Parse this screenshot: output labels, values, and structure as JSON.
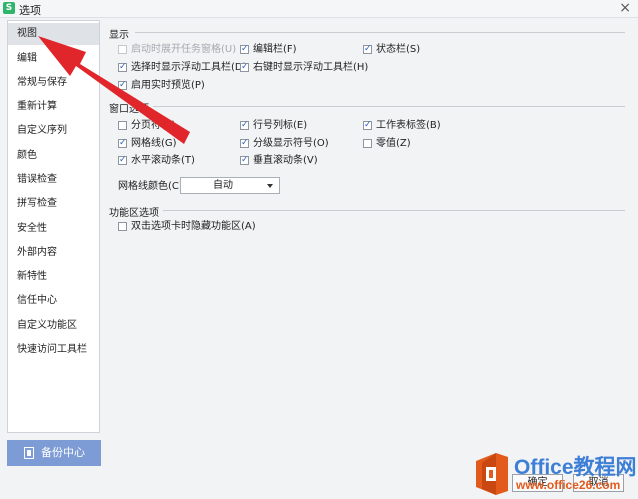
{
  "window": {
    "title": "选项",
    "close_glyph": "×"
  },
  "sidebar": {
    "items": [
      {
        "label": "视图",
        "active": true
      },
      {
        "label": "编辑"
      },
      {
        "label": "常规与保存"
      },
      {
        "label": "重新计算"
      },
      {
        "label": "自定义序列"
      },
      {
        "label": "颜色"
      },
      {
        "label": "错误检查"
      },
      {
        "label": "拼写检查"
      },
      {
        "label": "安全性"
      },
      {
        "label": "外部内容"
      },
      {
        "label": "新特性"
      },
      {
        "label": "信任中心"
      },
      {
        "label": "自定义功能区"
      },
      {
        "label": "快速访问工具栏"
      }
    ],
    "backup_label": "备份中心"
  },
  "display": {
    "title": "显示",
    "options": [
      {
        "label": "启动时展开任务窗格(U)",
        "checked": false,
        "disabled": true
      },
      {
        "label": "编辑栏(F)",
        "checked": true
      },
      {
        "label": "状态栏(S)",
        "checked": true
      },
      {
        "label": "选择时显示浮动工具栏(D)",
        "checked": true
      },
      {
        "label": "右键时显示浮动工具栏(H)",
        "checked": true
      },
      {
        "label": "启用实时预览(P)",
        "checked": true
      }
    ]
  },
  "window_options": {
    "title": "窗口选项",
    "options": [
      {
        "label": "分页符(K)",
        "checked": false
      },
      {
        "label": "行号列标(E)",
        "checked": true
      },
      {
        "label": "工作表标签(B)",
        "checked": true
      },
      {
        "label": "网格线(G)",
        "checked": true
      },
      {
        "label": "分级显示符号(O)",
        "checked": true
      },
      {
        "label": "零值(Z)",
        "checked": false
      },
      {
        "label": "水平滚动条(T)",
        "checked": true
      },
      {
        "label": "垂直滚动条(V)",
        "checked": true
      }
    ],
    "grid_color_label": "网格线颜色(C):",
    "grid_color_value": "自动"
  },
  "ribbon": {
    "title": "功能区选项",
    "options": [
      {
        "label": "双击选项卡时隐藏功能区(A)",
        "checked": false
      }
    ]
  },
  "footer": {
    "ok_label": "确定",
    "cancel_label": "取消"
  },
  "watermark": {
    "line1": "Office教程网",
    "line2": "www.office26.com"
  },
  "colors": {
    "accent": "#7d9bd4",
    "arrow": "#e0262b",
    "brand_orange": "#e25a1c",
    "brand_blue": "#3d7fd6"
  },
  "icons": {
    "app": "wps-spreadsheet-icon",
    "backup": "backup-icon",
    "check": "checkmark-icon"
  }
}
